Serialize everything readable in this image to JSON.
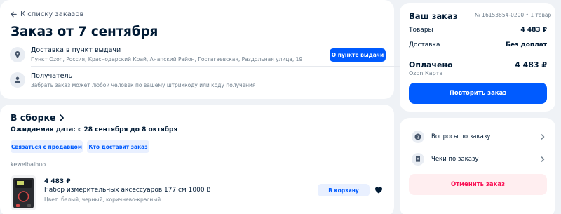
{
  "order": {
    "back_label": "К списку заказов",
    "title": "Заказ от 7 сентября",
    "delivery": {
      "title": "Доставка в пункт выдачи",
      "address": "Пункт Ozon, Россия, Краснодарский Край, Анапский Район, Гостагаевская, Раздольная улица, 19",
      "button": "О пункте выдачи"
    },
    "recipient": {
      "title": "Получатель",
      "note": "Забрать заказ может любой человек по вашему штрихкоду или коду получения"
    }
  },
  "assembly": {
    "status": "В сборке",
    "expected_date": "Ожидаемая дата: с 28 сентября до 8 октября",
    "chips": [
      "Связаться с продавцом",
      "Кто доставит заказ"
    ],
    "seller": "kewelbaihuo",
    "item": {
      "price": "4 483 ₽",
      "name": "Набор измерительных аксессуаров 177 см 1000 В",
      "attributes": "Цвет: белый, черный, коричнево-красный",
      "cart_button": "В корзину"
    }
  },
  "summary": {
    "title": "Ваш заказ",
    "meta": "№ 16153854-0200 • 1 товар",
    "rows": [
      {
        "label": "Товары",
        "value": "4 483 ₽"
      },
      {
        "label": "Доставка",
        "value": "Без доплат"
      }
    ],
    "paid_label": "Оплачено",
    "paid_value": "4 483 ₽",
    "payment_method": "Ozon Карта",
    "repeat_button": "Повторить заказ"
  },
  "links": {
    "questions": "Вопросы по заказу",
    "receipts": "Чеки по заказу",
    "cancel_button": "Отменить заказ"
  },
  "colors": {
    "accent": "#005bff",
    "danger": "#f91155",
    "background": "#eff2f6"
  }
}
